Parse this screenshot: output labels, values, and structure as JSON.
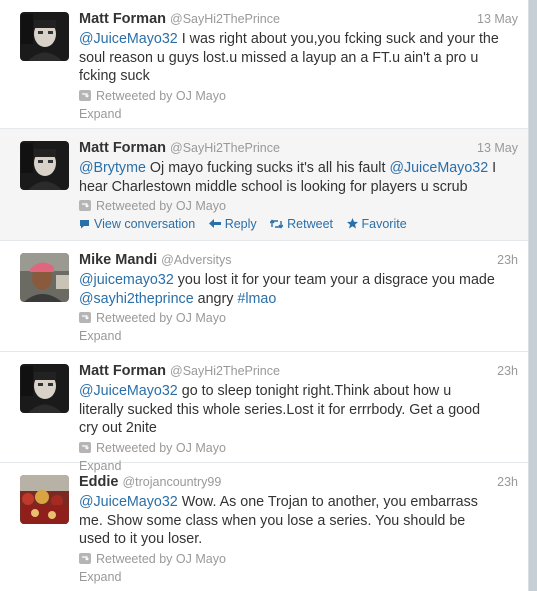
{
  "tweets": [
    {
      "name": "Matt Forman",
      "handle": "@SayHi2ThePrince",
      "time": "13 May",
      "segments": [
        {
          "t": "@JuiceMayo32",
          "m": true
        },
        {
          "t": " I was right about you,you fcking suck and your the soul reason u guys lost.u missed a layup an a FT.u ain't a pro u fcking suck",
          "m": false
        }
      ],
      "retweeted_by": "Retweeted by OJ Mayo",
      "expand": "Expand"
    },
    {
      "name": "Matt Forman",
      "handle": "@SayHi2ThePrince",
      "time": "13 May",
      "segments": [
        {
          "t": "@Brytyme",
          "m": true
        },
        {
          "t": " Oj mayo fucking sucks it's all his fault ",
          "m": false
        },
        {
          "t": "@JuiceMayo32",
          "m": true
        },
        {
          "t": " I hear Charlestown middle school is looking for players u scrub",
          "m": false
        }
      ],
      "retweeted_by": "Retweeted by OJ Mayo",
      "actions": {
        "view_conversation": "View conversation",
        "reply": "Reply",
        "retweet": "Retweet",
        "favorite": "Favorite"
      }
    },
    {
      "name": "Mike Mandi",
      "handle": "@Adversitys",
      "time": "23h",
      "segments": [
        {
          "t": "@juicemayo32",
          "m": true
        },
        {
          "t": " you lost it for your team your a disgrace you made ",
          "m": false
        },
        {
          "t": "@sayhi2theprince",
          "m": true
        },
        {
          "t": " angry ",
          "m": false
        },
        {
          "t": "#lmao",
          "m": true
        }
      ],
      "retweeted_by": "Retweeted by OJ Mayo",
      "expand": "Expand"
    },
    {
      "name": "Matt Forman",
      "handle": "@SayHi2ThePrince",
      "time": "23h",
      "segments": [
        {
          "t": "@JuiceMayo32",
          "m": true
        },
        {
          "t": " go to sleep tonight right.Think about how u literally sucked this whole series.Lost it for errrbody. Get a good cry out 2nite",
          "m": false
        }
      ],
      "retweeted_by": "Retweeted by OJ Mayo",
      "expand": "Expand"
    },
    {
      "name": "Eddie",
      "handle": "@trojancountry99",
      "time": "23h",
      "segments": [
        {
          "t": "@JuiceMayo32",
          "m": true
        },
        {
          "t": " Wow. As one Trojan to another, you embarrass me. Show some class when you lose a series. You should be used to it you loser.",
          "m": false
        }
      ],
      "retweeted_by": "Retweeted by OJ Mayo",
      "expand": "Expand"
    }
  ],
  "colors": {
    "link": "#2a6fa8",
    "muted": "#999999",
    "text": "#333333",
    "hover_bg": "#f5f5f5"
  },
  "icons": {
    "retweet": "retweet-icon",
    "reply": "reply-icon",
    "favorite": "star-icon",
    "conversation": "speech-bubble-icon"
  }
}
